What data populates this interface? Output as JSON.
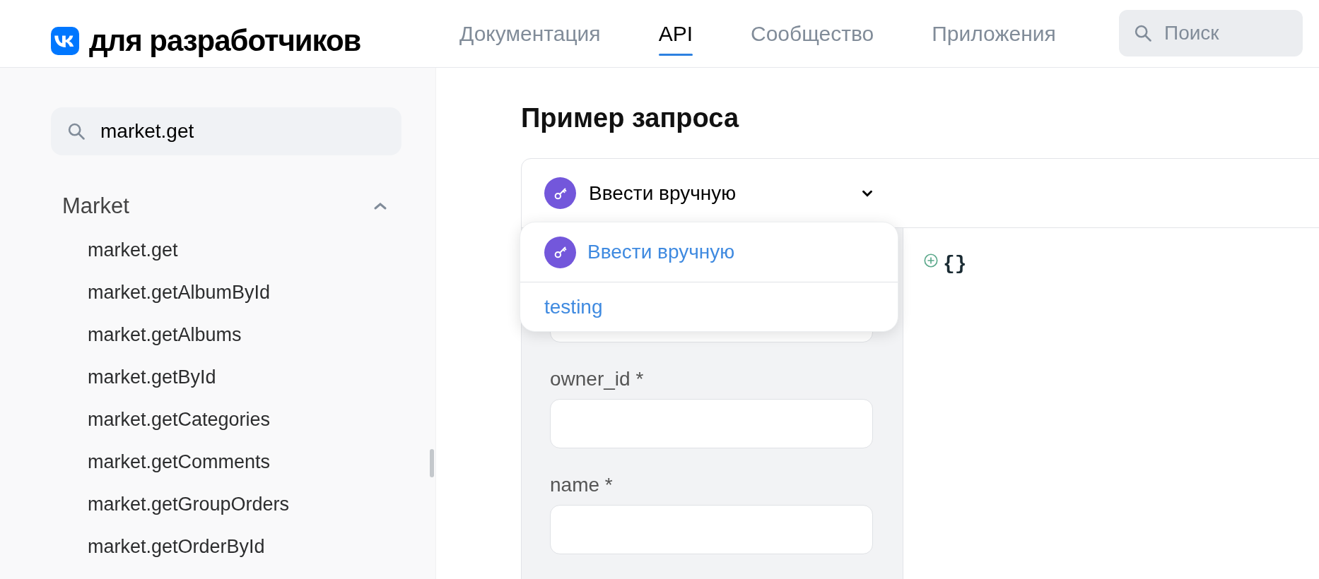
{
  "header": {
    "logo_text": "для разработчиков",
    "nav": [
      {
        "label": "Документация",
        "selected": false
      },
      {
        "label": "API",
        "selected": true
      },
      {
        "label": "Сообщество",
        "selected": false
      },
      {
        "label": "Приложения",
        "selected": false
      }
    ],
    "search": {
      "placeholder": "Поиск"
    }
  },
  "sidebar": {
    "search": {
      "value": "market.get"
    },
    "section": {
      "title": "Market",
      "expanded": true,
      "items": [
        "market.get",
        "market.getAlbumById",
        "market.getAlbums",
        "market.getById",
        "market.getCategories",
        "market.getComments",
        "market.getGroupOrders",
        "market.getOrderById"
      ]
    }
  },
  "main": {
    "title": "Пример запроса",
    "token_select": {
      "value": "Ввести вручную",
      "expanded": true,
      "options": [
        {
          "label": "Ввести вручную",
          "kind": "key"
        },
        {
          "label": "testing",
          "kind": "plain"
        }
      ]
    },
    "fields": [
      {
        "label": "owner_id *"
      },
      {
        "label": "name *"
      }
    ],
    "response_preview": "{}"
  }
}
